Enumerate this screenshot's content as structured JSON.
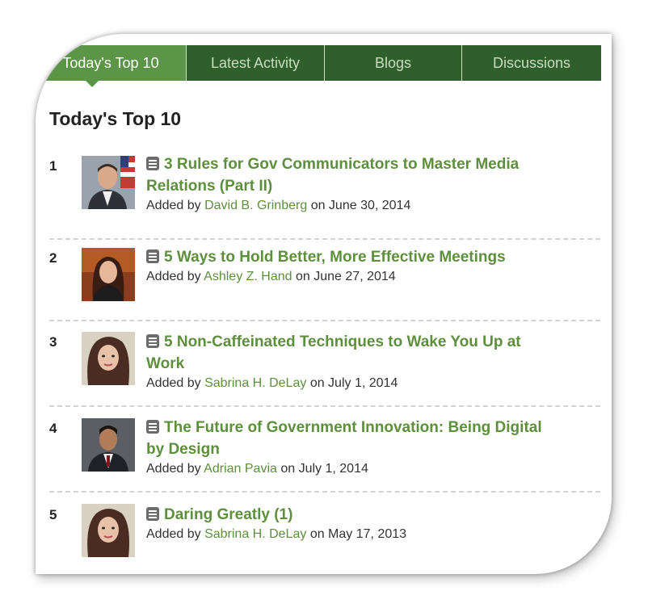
{
  "tabs": [
    {
      "label": "Today's Top 10",
      "active": true
    },
    {
      "label": "Latest Activity",
      "active": false
    },
    {
      "label": "Blogs",
      "active": false
    },
    {
      "label": "Discussions",
      "active": false
    }
  ],
  "heading": "Today's Top 10",
  "colors": {
    "tab_dark": "#2f5f2b",
    "tab_active": "#5d9548",
    "link": "#5d8f3c"
  },
  "items": [
    {
      "rank": "1",
      "title_line1": "3 Rules for Gov Communicators to Master Media",
      "title_line2": "Relations (Part II)",
      "added_by": "Added by",
      "author": "David B. Grinberg",
      "on_date": "on June 30, 2014",
      "icon": "document-icon"
    },
    {
      "rank": "2",
      "title_line1": "5 Ways to Hold Better, More Effective Meetings",
      "title_line2": "",
      "added_by": "Added by",
      "author": "Ashley Z. Hand",
      "on_date": "on June 27, 2014",
      "icon": "document-icon"
    },
    {
      "rank": "3",
      "title_line1": "5 Non-Caffeinated Techniques to Wake You Up at",
      "title_line2": "Work",
      "added_by": "Added by",
      "author": "Sabrina H. DeLay",
      "on_date": "on July 1, 2014",
      "icon": "document-icon"
    },
    {
      "rank": "4",
      "title_line1": "The Future of Government Innovation: Being Digital",
      "title_line2": "by Design",
      "added_by": "Added by",
      "author": "Adrian Pavia",
      "on_date": "on July 1, 2014",
      "icon": "document-icon"
    },
    {
      "rank": "5",
      "title_line1": "Daring Greatly (1)",
      "title_line2": "",
      "added_by": "Added by",
      "author": "Sabrina H. DeLay",
      "on_date": "on May 17, 2013",
      "icon": "document-icon"
    }
  ]
}
